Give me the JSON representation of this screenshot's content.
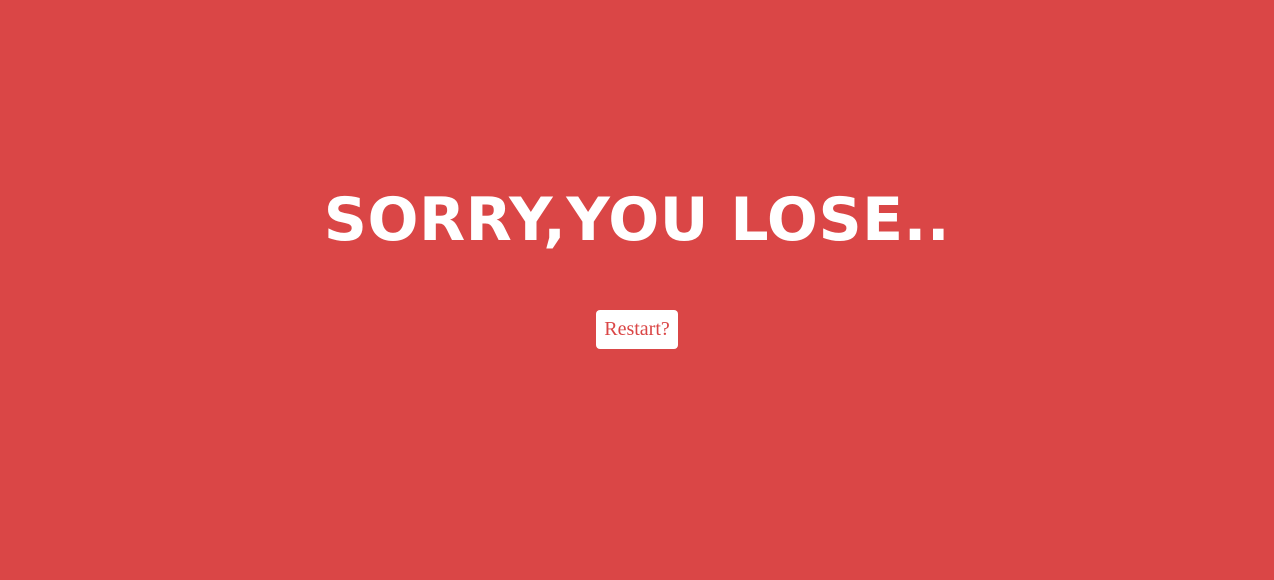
{
  "game_over": {
    "title": "SORRY,YOU LOSE..",
    "restart_label": "Restart?"
  },
  "colors": {
    "background": "#da4646",
    "title_text": "#ffffff",
    "button_background": "#ffffff",
    "button_text": "#da4646"
  }
}
